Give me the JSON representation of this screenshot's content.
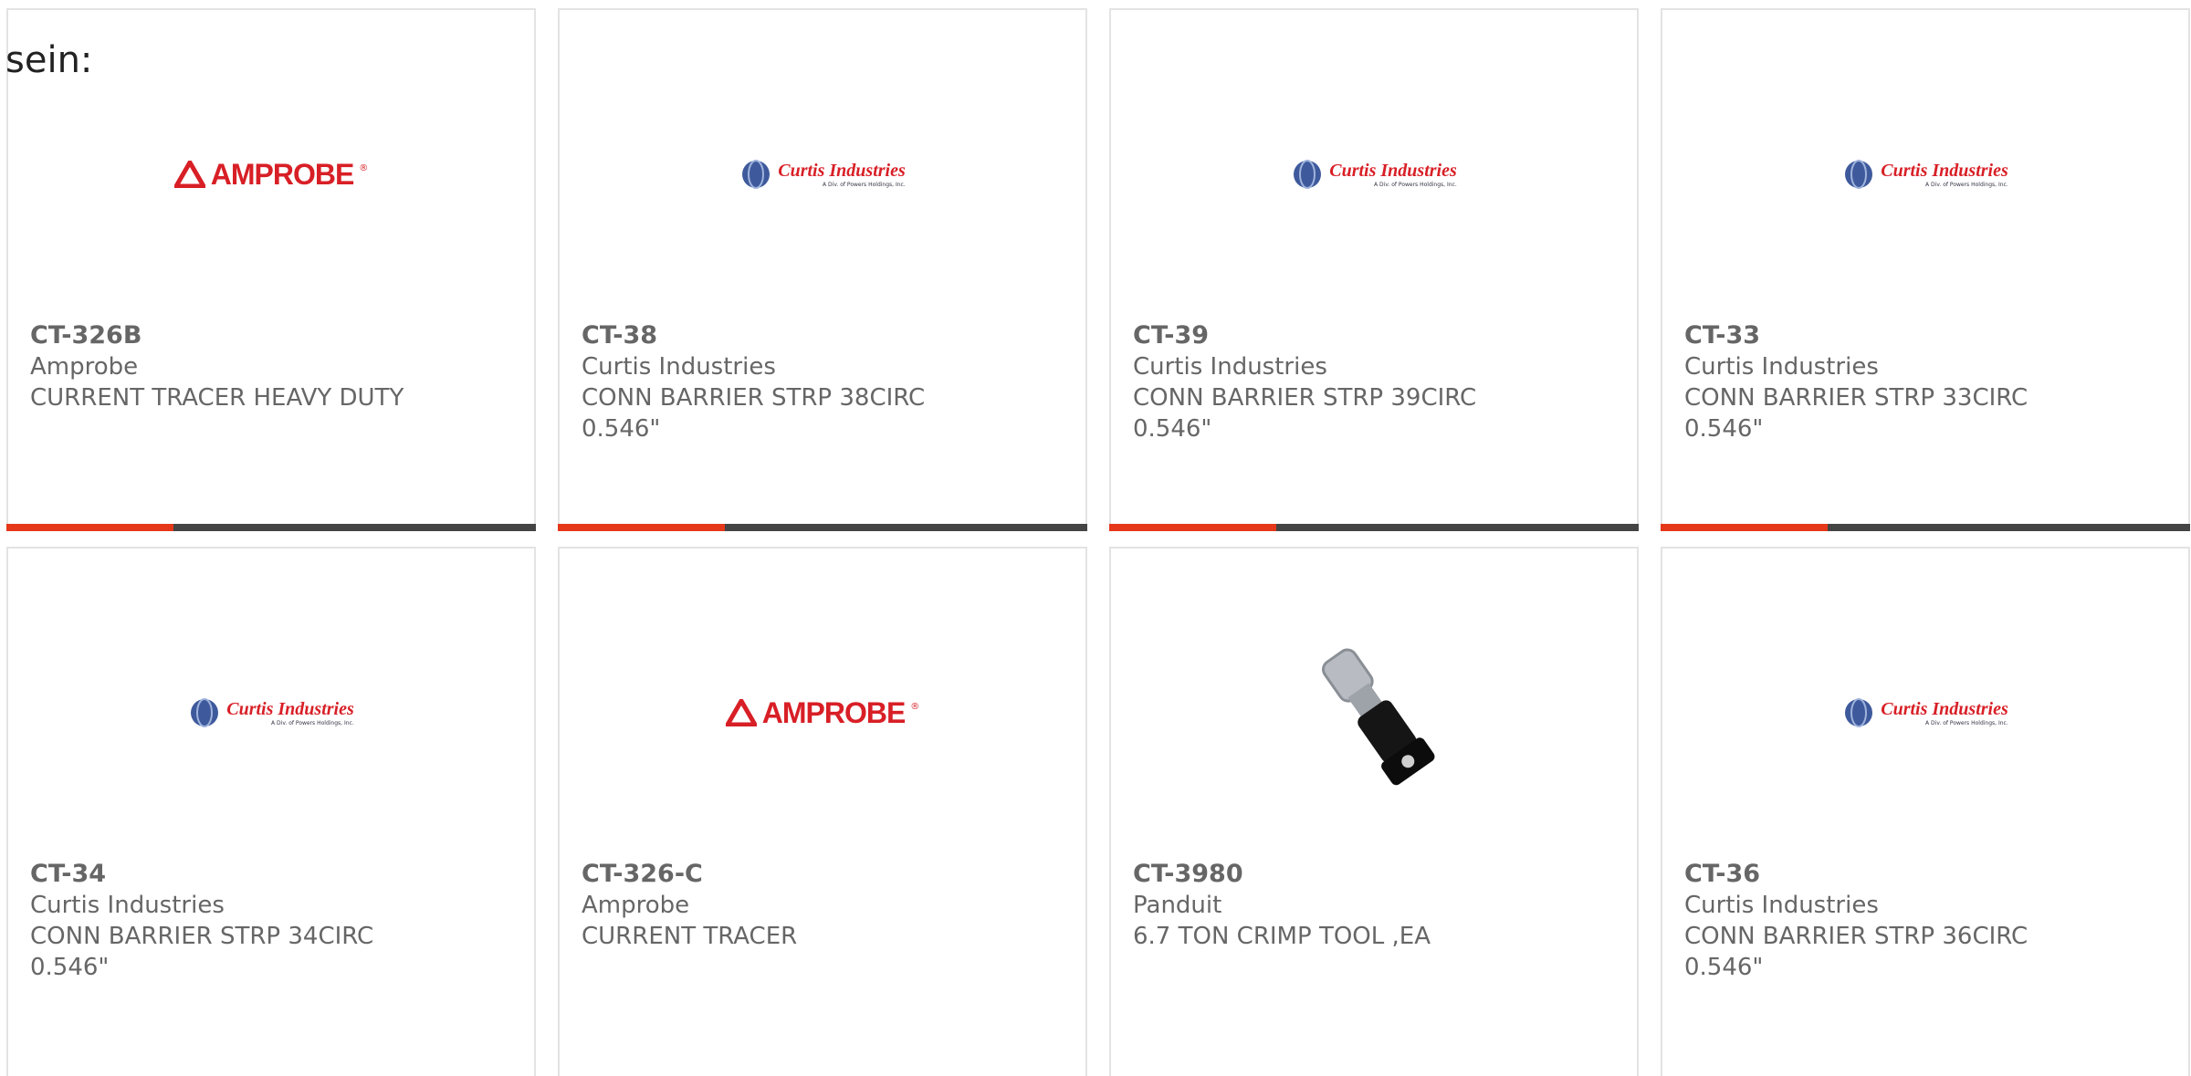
{
  "intro_text": "sein:",
  "colors": {
    "accent": "#e5381a",
    "bar": "#444444",
    "text": "#666666",
    "amprobe_red": "#d81f26"
  },
  "logos": {
    "amprobe": {
      "word": "AMPROBE",
      "reg": "®"
    },
    "curtis": {
      "name": "Curtis Industries",
      "sub": "A Div. of Powers Holdings, Inc."
    }
  },
  "products": [
    {
      "part": "CT-326B",
      "brand": "Amprobe",
      "desc": "CURRENT TRACER HEAVY DUTY",
      "extra": "",
      "logo": "amprobe-logo"
    },
    {
      "part": "CT-38",
      "brand": "Curtis Industries",
      "desc": "CONN BARRIER STRP 38CIRC",
      "extra": "0.546\"",
      "logo": "curtis-logo"
    },
    {
      "part": "CT-39",
      "brand": "Curtis Industries",
      "desc": "CONN BARRIER STRP 39CIRC",
      "extra": "0.546\"",
      "logo": "curtis-logo"
    },
    {
      "part": "CT-33",
      "brand": "Curtis Industries",
      "desc": "CONN BARRIER STRP 33CIRC",
      "extra": "0.546\"",
      "logo": "curtis-logo"
    },
    {
      "part": "CT-34",
      "brand": "Curtis Industries",
      "desc": "CONN BARRIER STRP 34CIRC",
      "extra": "0.546\"",
      "logo": "curtis-logo"
    },
    {
      "part": "CT-326-C",
      "brand": "Amprobe",
      "desc": "CURRENT TRACER",
      "extra": "",
      "logo": "amprobe-logo"
    },
    {
      "part": "CT-3980",
      "brand": "Panduit",
      "desc": "6.7 TON CRIMP TOOL ,EA",
      "extra": "",
      "logo": "crimp-tool-photo"
    },
    {
      "part": "CT-36",
      "brand": "Curtis Industries",
      "desc": "CONN BARRIER STRP 36CIRC",
      "extra": "0.546\"",
      "logo": "curtis-logo"
    }
  ]
}
